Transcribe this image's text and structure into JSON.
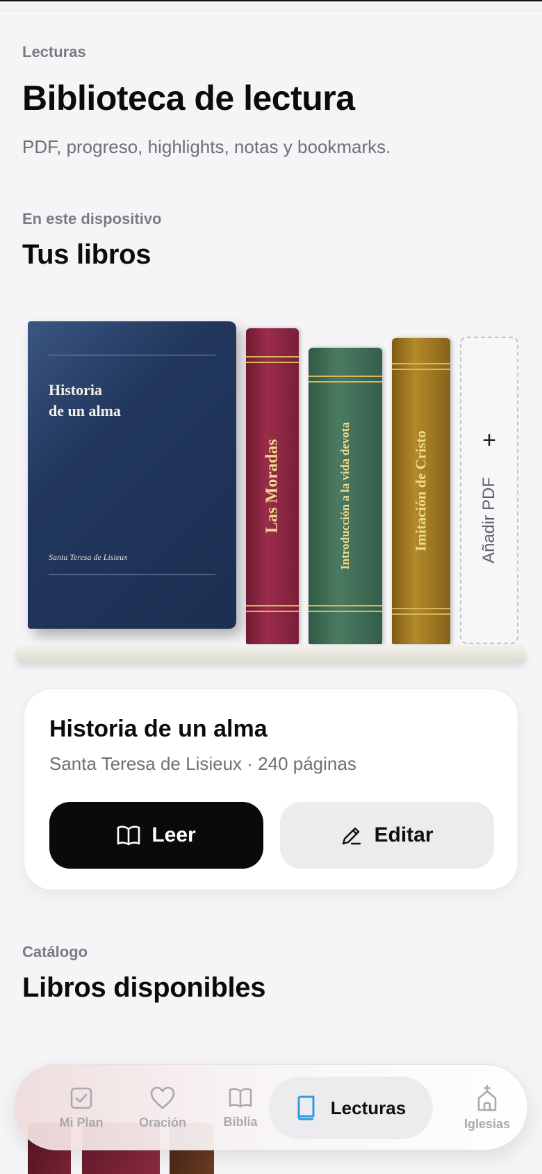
{
  "header": {
    "eyebrow": "Lecturas",
    "title": "Biblioteca de lectura",
    "subtitle": "PDF, progreso, highlights, notas y bookmarks."
  },
  "my_books": {
    "eyebrow": "En este dispositivo",
    "title": "Tus libros",
    "featured": {
      "title": "Historia\nde un alma",
      "author": "Santa Teresa de Lisieux"
    },
    "spines": [
      "Las Moradas",
      "Introducción a la vida devota",
      "Imitación de Cristo"
    ],
    "add_pdf": "Añadir PDF"
  },
  "detail": {
    "title": "Historia de un alma",
    "meta": "Santa Teresa de Lisieux · 240 páginas",
    "read_label": "Leer",
    "edit_label": "Editar"
  },
  "catalog": {
    "eyebrow": "Catálogo",
    "title": "Libros disponibles"
  },
  "tabbar": {
    "items": [
      {
        "label": "Mi Plan",
        "icon": "checkbox-icon"
      },
      {
        "label": "Oración",
        "icon": "heart-icon"
      },
      {
        "label": "Biblia",
        "icon": "open-book-icon"
      },
      {
        "label": "Lecturas",
        "icon": "book-icon",
        "active": true
      },
      {
        "label": "Iglesias",
        "icon": "church-icon"
      }
    ],
    "active_color": "#2f9be0"
  }
}
